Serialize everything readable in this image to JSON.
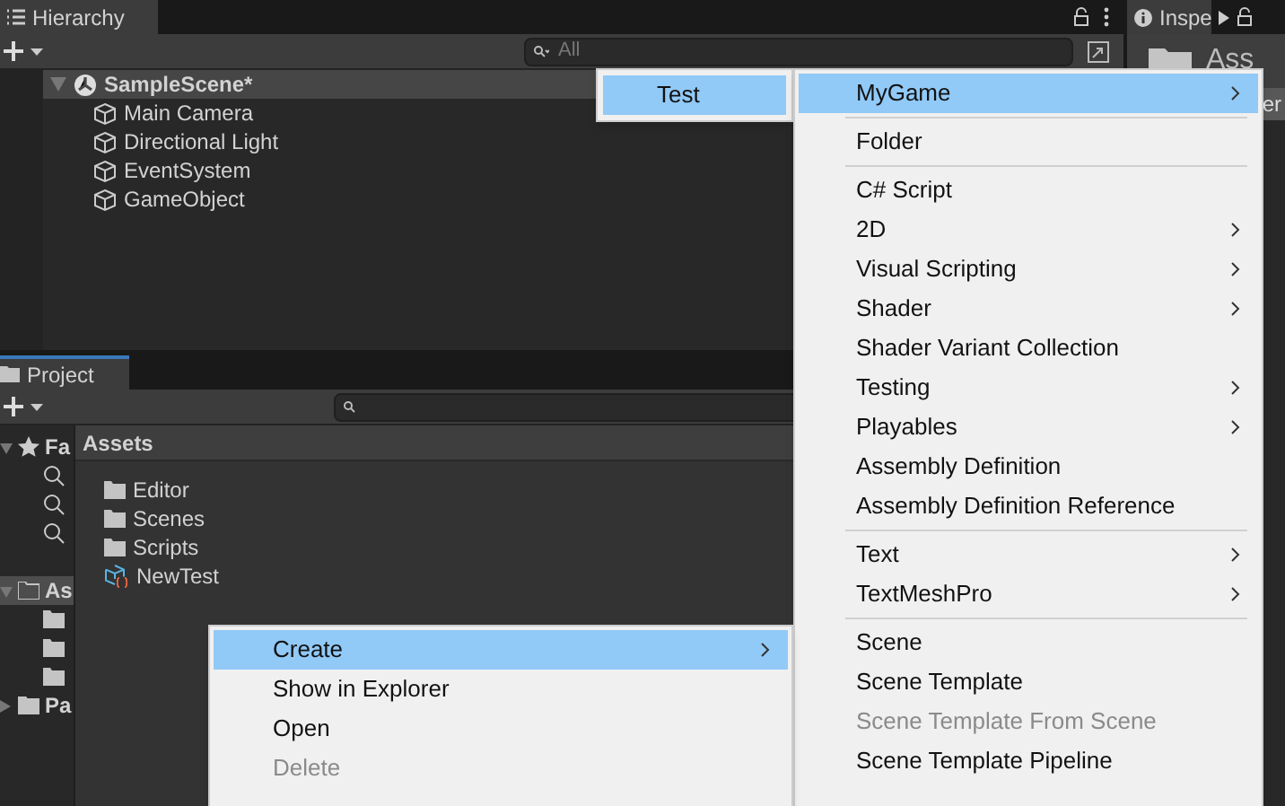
{
  "hierarchy": {
    "tab": "Hierarchy",
    "search_placeholder": "All",
    "scene": {
      "name": "SampleScene*",
      "expanded": true,
      "children": [
        {
          "name": "Main Camera"
        },
        {
          "name": "Directional Light"
        },
        {
          "name": "EventSystem"
        },
        {
          "name": "GameObject"
        }
      ]
    }
  },
  "inspector": {
    "tab": "Inspe",
    "header": "Ass",
    "column_2": "er"
  },
  "project": {
    "tab": "Project",
    "tree": [
      {
        "label": "Fa",
        "kind": "favorites",
        "expanded": true,
        "selected": false,
        "children": [
          {
            "kind": "search"
          },
          {
            "kind": "search"
          },
          {
            "kind": "search"
          }
        ]
      },
      {
        "label": "As",
        "kind": "folder",
        "expanded": true,
        "selected": true,
        "children": [
          {
            "kind": "folder"
          },
          {
            "kind": "folder"
          },
          {
            "kind": "folder"
          }
        ]
      },
      {
        "label": "Pa",
        "kind": "folder",
        "expanded": false,
        "selected": false
      }
    ],
    "breadcrumb": "Assets",
    "items": [
      {
        "name": "Editor",
        "kind": "folder"
      },
      {
        "name": "Scenes",
        "kind": "folder"
      },
      {
        "name": "Scripts",
        "kind": "folder"
      },
      {
        "name": "NewTest",
        "kind": "asset"
      }
    ]
  },
  "context_menu": [
    {
      "label": "Create",
      "submenu": true,
      "selected": true,
      "disabled": false
    },
    {
      "label": "Show in Explorer",
      "submenu": false,
      "selected": false,
      "disabled": false
    },
    {
      "label": "Open",
      "submenu": false,
      "selected": false,
      "disabled": false
    },
    {
      "label": "Delete",
      "submenu": false,
      "selected": false,
      "disabled": true
    }
  ],
  "create_menu": [
    {
      "kind": "item",
      "label": "MyGame",
      "submenu": true,
      "selected": true,
      "disabled": false
    },
    {
      "kind": "separator"
    },
    {
      "kind": "item",
      "label": "Folder",
      "submenu": false,
      "selected": false,
      "disabled": false
    },
    {
      "kind": "separator"
    },
    {
      "kind": "item",
      "label": "C# Script",
      "submenu": false,
      "selected": false,
      "disabled": false
    },
    {
      "kind": "item",
      "label": "2D",
      "submenu": true,
      "selected": false,
      "disabled": false
    },
    {
      "kind": "item",
      "label": "Visual Scripting",
      "submenu": true,
      "selected": false,
      "disabled": false
    },
    {
      "kind": "item",
      "label": "Shader",
      "submenu": true,
      "selected": false,
      "disabled": false
    },
    {
      "kind": "item",
      "label": "Shader Variant Collection",
      "submenu": false,
      "selected": false,
      "disabled": false
    },
    {
      "kind": "item",
      "label": "Testing",
      "submenu": true,
      "selected": false,
      "disabled": false
    },
    {
      "kind": "item",
      "label": "Playables",
      "submenu": true,
      "selected": false,
      "disabled": false
    },
    {
      "kind": "item",
      "label": "Assembly Definition",
      "submenu": false,
      "selected": false,
      "disabled": false
    },
    {
      "kind": "item",
      "label": "Assembly Definition Reference",
      "submenu": false,
      "selected": false,
      "disabled": false
    },
    {
      "kind": "separator"
    },
    {
      "kind": "item",
      "label": "Text",
      "submenu": true,
      "selected": false,
      "disabled": false
    },
    {
      "kind": "item",
      "label": "TextMeshPro",
      "submenu": true,
      "selected": false,
      "disabled": false
    },
    {
      "kind": "separator"
    },
    {
      "kind": "item",
      "label": "Scene",
      "submenu": false,
      "selected": false,
      "disabled": false
    },
    {
      "kind": "item",
      "label": "Scene Template",
      "submenu": false,
      "selected": false,
      "disabled": false
    },
    {
      "kind": "item",
      "label": "Scene Template From Scene",
      "submenu": false,
      "selected": false,
      "disabled": true
    },
    {
      "kind": "item",
      "label": "Scene Template Pipeline",
      "submenu": false,
      "selected": false,
      "disabled": false
    }
  ],
  "mygame_menu": [
    {
      "label": "Test",
      "selected": true
    }
  ]
}
